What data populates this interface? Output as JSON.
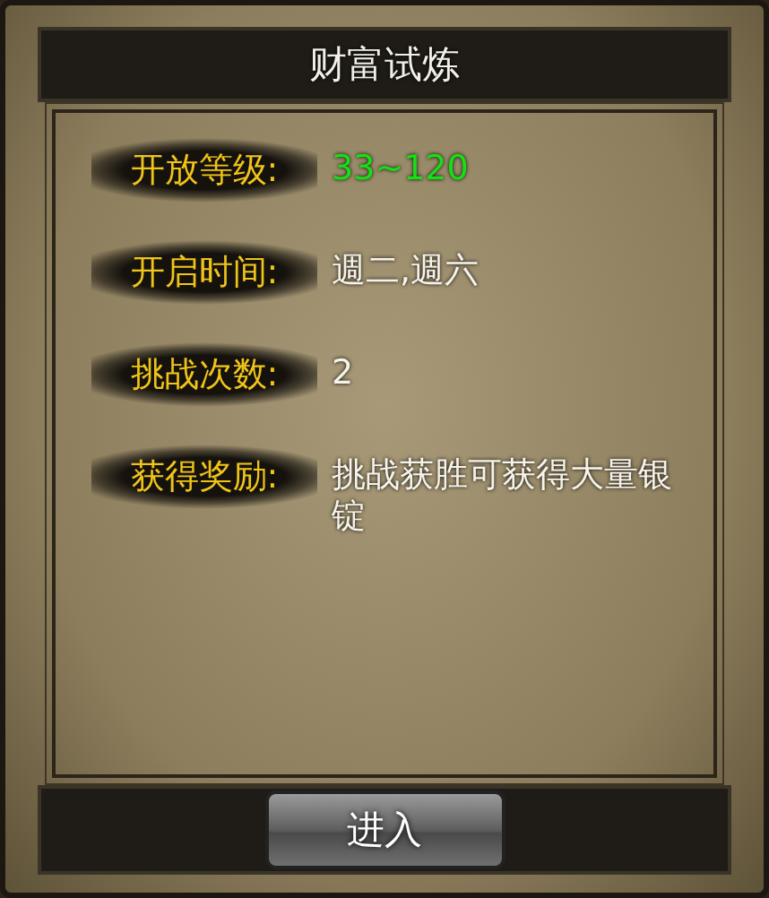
{
  "title": "财富试炼",
  "rows": [
    {
      "label": "开放等级:",
      "value": "33~120",
      "highlighted": true
    },
    {
      "label": "开启时间:",
      "value": "週二,週六",
      "highlighted": false
    },
    {
      "label": "挑战次数:",
      "value": "2",
      "highlighted": false
    },
    {
      "label": "获得奖励:",
      "value": "挑战获胜可获得大量银锭",
      "highlighted": false
    }
  ],
  "button": "进入"
}
